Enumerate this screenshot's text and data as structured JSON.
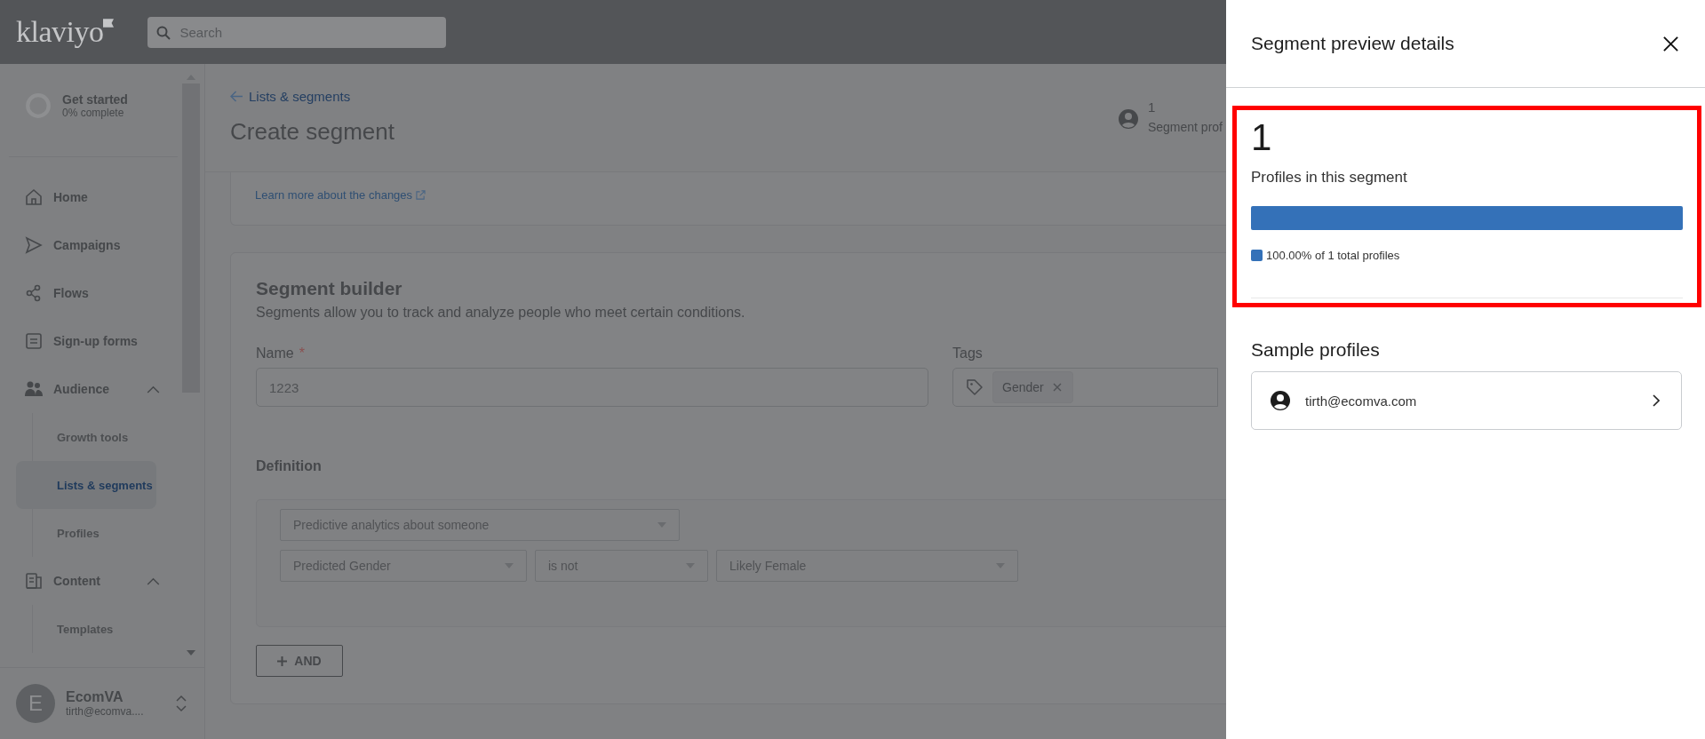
{
  "topbar": {
    "logo": "klaviyo",
    "search": {
      "placeholder": "Search"
    }
  },
  "sidebar": {
    "get_started": {
      "title": "Get started",
      "subtitle": "0% complete"
    },
    "items": [
      {
        "label": "Home"
      },
      {
        "label": "Campaigns"
      },
      {
        "label": "Flows"
      },
      {
        "label": "Sign-up forms"
      },
      {
        "label": "Audience",
        "expanded": true,
        "children": [
          {
            "label": "Growth tools",
            "selected": false
          },
          {
            "label": "Lists & segments",
            "selected": true
          },
          {
            "label": "Profiles",
            "selected": false
          }
        ]
      },
      {
        "label": "Content",
        "expanded": true,
        "children": [
          {
            "label": "Templates",
            "selected": false
          }
        ]
      }
    ],
    "user": {
      "initial": "E",
      "name": "EcomVA",
      "email": "tirth@ecomva...."
    }
  },
  "page": {
    "back_link": "Lists & segments",
    "title": "Create segment",
    "profile_count": {
      "value": "1",
      "label": "Segment prof"
    }
  },
  "notice": {
    "link": "Learn more about the changes"
  },
  "builder": {
    "title": "Segment builder",
    "subtitle": "Segments allow you to track and analyze people who meet certain conditions.",
    "name_field": {
      "label": "Name",
      "required_mark": "*",
      "value": "1223"
    },
    "tags_field": {
      "label": "Tags",
      "tags": [
        "Gender"
      ]
    },
    "definition": {
      "label": "Definition",
      "conditions": [
        [
          "Predictive analytics about someone"
        ],
        [
          "Predicted Gender",
          "is not",
          "Likely Female"
        ]
      ]
    },
    "and_button": "AND"
  },
  "panel": {
    "title": "Segment preview details",
    "stats": {
      "count": "1",
      "label": "Profiles in this segment",
      "level": 1,
      "legend": "100.00% of 1 total profiles"
    },
    "samples": {
      "title": "Sample profiles",
      "profiles": [
        "tirth@ecomva.com"
      ]
    }
  }
}
